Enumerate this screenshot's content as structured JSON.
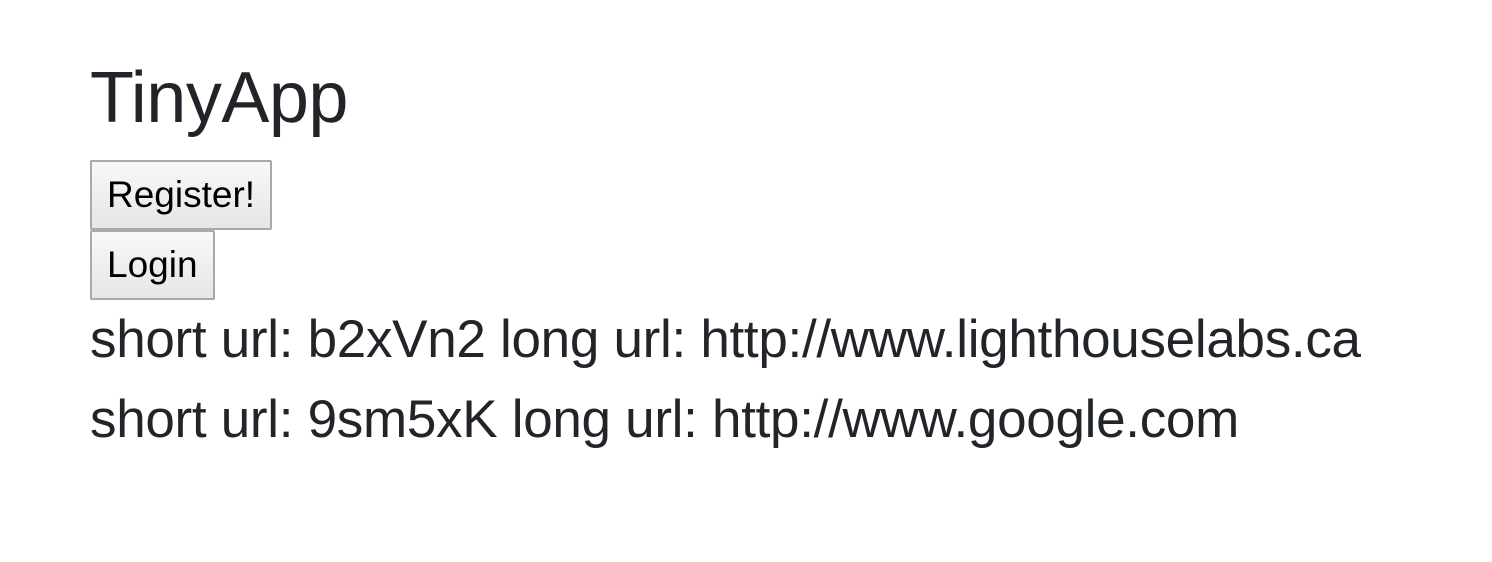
{
  "header": {
    "title": "TinyApp"
  },
  "actions": {
    "register_label": "Register!",
    "login_label": "Login"
  },
  "urls": [
    {
      "short_label": "short url:",
      "short_url": "b2xVn2",
      "long_label": "long url:",
      "long_url": "http://www.lighthouselabs.ca"
    },
    {
      "short_label": "short url:",
      "short_url": "9sm5xK",
      "long_label": "long url:",
      "long_url": "http://www.google.com"
    }
  ]
}
